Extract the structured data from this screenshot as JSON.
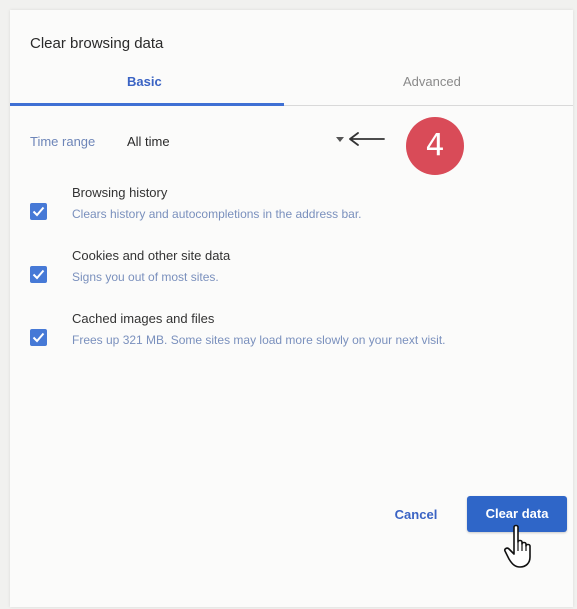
{
  "dialog": {
    "title": "Clear browsing data",
    "tabs": [
      {
        "label": "Basic",
        "active": true
      },
      {
        "label": "Advanced",
        "active": false
      }
    ],
    "time_range": {
      "label": "Time range",
      "value": "All time"
    },
    "options": [
      {
        "title": "Browsing history",
        "description": "Clears history and autocompletions in the address bar.",
        "checked": true
      },
      {
        "title": "Cookies and other site data",
        "description": "Signs you out of most sites.",
        "checked": true
      },
      {
        "title": "Cached images and files",
        "description": "Frees up 321 MB. Some sites may load more slowly on your next visit.",
        "checked": true
      }
    ],
    "buttons": {
      "cancel": "Cancel",
      "clear": "Clear data"
    }
  },
  "annotation": {
    "step_number": "4",
    "arrow_icon": "left-arrow-icon",
    "badge_color": "#d94b58"
  },
  "colors": {
    "accent": "#3f70d4",
    "checkbox": "#4679d6",
    "primary_button": "#2f66c8"
  }
}
